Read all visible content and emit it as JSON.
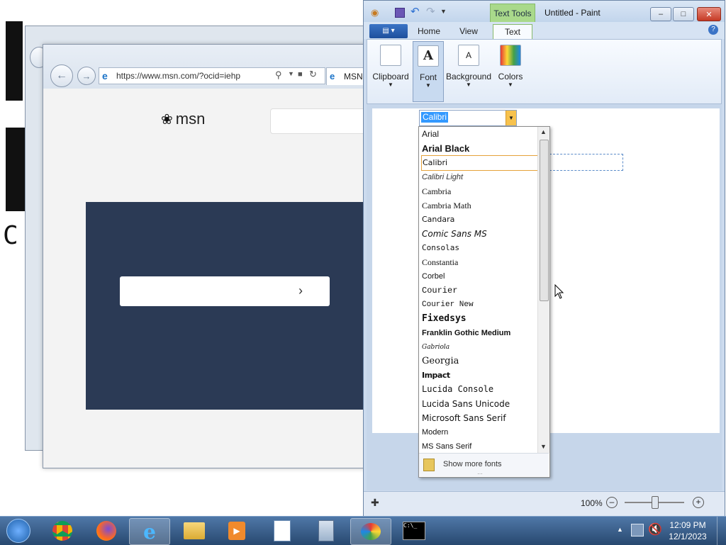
{
  "ie_window": {
    "address_url": "https://www.msn.com/?ocid=iehp",
    "tab_label": "MSN",
    "logo_text": "msn",
    "back_icon": "arrow-left-icon",
    "forward_icon": "arrow-right-icon"
  },
  "paint_window": {
    "title": "Untitled - Paint",
    "contextual_tab": "Text Tools",
    "tabs": [
      "Home",
      "View",
      "Text"
    ],
    "active_tab": "Text",
    "ribbon_groups": [
      "Clipboard",
      "Font",
      "Background",
      "Colors"
    ],
    "font_combo_value": "Calibri",
    "zoom": "100%"
  },
  "font_dropdown": {
    "items": [
      "Arial",
      "Arial Black",
      "Calibri",
      "Calibri Light",
      "Cambria",
      "Cambria Math",
      "Candara",
      "Comic Sans MS",
      "Consolas",
      "Constantia",
      "Corbel",
      "Courier",
      "Courier New",
      "Fixedsys",
      "Franklin Gothic Medium",
      "Gabriola",
      "Georgia",
      "Impact",
      "Lucida Console",
      "Lucida Sans Unicode",
      "Microsoft Sans Serif",
      "Modern",
      "MS Sans Serif"
    ],
    "selected": "Calibri",
    "show_more_label": "Show more fonts"
  },
  "taskbar": {
    "items": [
      "start-orb",
      "chrome",
      "firefox",
      "internet-explorer",
      "file-explorer",
      "media-player",
      "wordpad",
      "calculator",
      "paint",
      "command-prompt"
    ],
    "time": "12:09 PM",
    "date": "12/1/2023"
  },
  "colors": {
    "taskbar": "#2f5683",
    "msn_banner": "#2b3a55",
    "selection_highlight": "#3399ff",
    "selected_item_border": "#e5a23a"
  }
}
